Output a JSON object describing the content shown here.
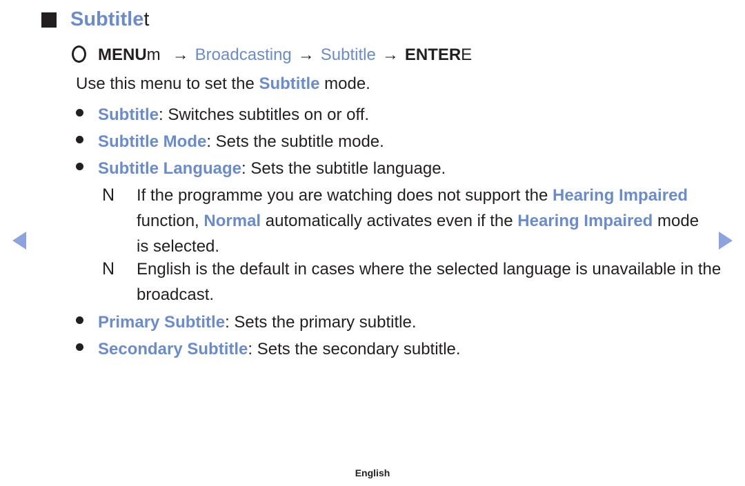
{
  "page": {
    "heading": {
      "highlight": "Subtitle",
      "suffix": "t"
    },
    "menu_path": {
      "ring_glyph": "O",
      "menu_label": "MENU",
      "menu_suffix": "m",
      "arrow1": "→",
      "item1": "Broadcasting",
      "arrow2": "→",
      "item2": "Subtitle",
      "arrow3": "→",
      "enter_label": "ENTER",
      "enter_suffix": "E"
    },
    "intro": {
      "before": "Use this menu to set the ",
      "highlight": "Subtitle",
      "after": " mode."
    },
    "bullets_top": [
      {
        "term": "Subtitle",
        "desc": ": Switches subtitles on or off."
      },
      {
        "term": "Subtitle Mode",
        "desc": ": Sets the subtitle mode."
      },
      {
        "term": "Subtitle Language",
        "desc": ": Sets the subtitle language."
      }
    ],
    "notes": [
      {
        "glyph": "N",
        "seg1": "If the programme you are watching does not support the ",
        "hl1": "Hearing Impaired",
        "seg2": " function, ",
        "hl2": "Normal",
        "seg3": " automatically activates even if the ",
        "hl3": "Hearing Impaired",
        "seg4": " mode is selected."
      },
      {
        "glyph": "N",
        "seg1": "English is the default in cases where the selected language is unavailable in the broadcast.",
        "hl1": "",
        "seg2": "",
        "hl2": "",
        "seg3": "",
        "hl3": "",
        "seg4": ""
      }
    ],
    "bullets_bottom": [
      {
        "term": "Primary Subtitle",
        "desc": ": Sets the primary subtitle."
      },
      {
        "term": "Secondary Subtitle",
        "desc": ": Sets the secondary subtitle."
      }
    ],
    "footer": "English",
    "nav": {
      "prev": "◀",
      "next": "▶"
    },
    "colors": {
      "accent_blue": "#6a8ccc",
      "arrow_blue": "#8da3de",
      "text_black": "#231f20"
    }
  }
}
